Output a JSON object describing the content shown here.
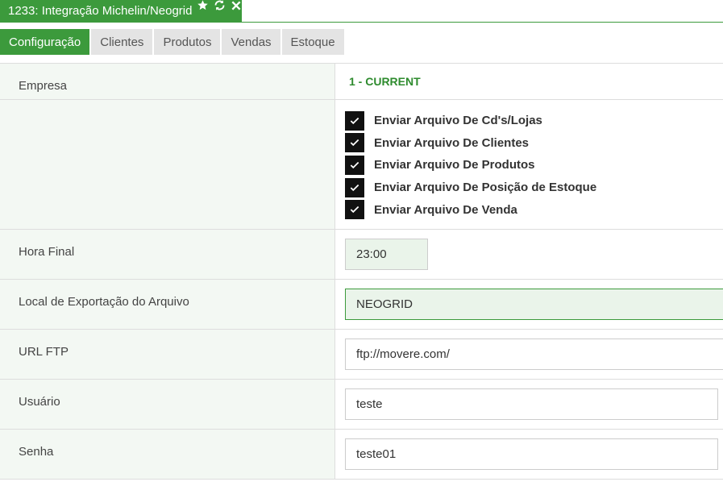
{
  "window": {
    "title": "1233: Integração Michelin/Neogrid",
    "icons": [
      "star-icon",
      "refresh-icon",
      "close-icon"
    ]
  },
  "tabs": [
    {
      "label": "Configuração",
      "active": true
    },
    {
      "label": "Clientes",
      "active": false
    },
    {
      "label": "Produtos",
      "active": false
    },
    {
      "label": "Vendas",
      "active": false
    },
    {
      "label": "Estoque",
      "active": false
    }
  ],
  "form": {
    "empresa": {
      "label": "Empresa",
      "value": "1 - CURRENT"
    },
    "checks": [
      {
        "label": "Enviar Arquivo De Cd's/Lojas",
        "checked": true
      },
      {
        "label": "Enviar Arquivo De Clientes",
        "checked": true
      },
      {
        "label": "Enviar Arquivo De Produtos",
        "checked": true
      },
      {
        "label": "Enviar Arquivo De Posição de Estoque",
        "checked": true
      },
      {
        "label": "Enviar Arquivo De Venda",
        "checked": true
      }
    ],
    "hora_final": {
      "label": "Hora Final",
      "value": "23:00"
    },
    "local_exportacao": {
      "label": "Local de Exportação do Arquivo",
      "value": "NEOGRID"
    },
    "url_ftp": {
      "label": "URL FTP",
      "value": "ftp://movere.com/"
    },
    "usuario": {
      "label": "Usuário",
      "value": "teste"
    },
    "senha": {
      "label": "Senha",
      "value": "teste01"
    }
  },
  "colors": {
    "accent": "#3c9a3c",
    "label_bg": "#f3f8f3",
    "highlight_input_bg": "#eaf4ea",
    "empresa_text": "#2e8b2e"
  }
}
